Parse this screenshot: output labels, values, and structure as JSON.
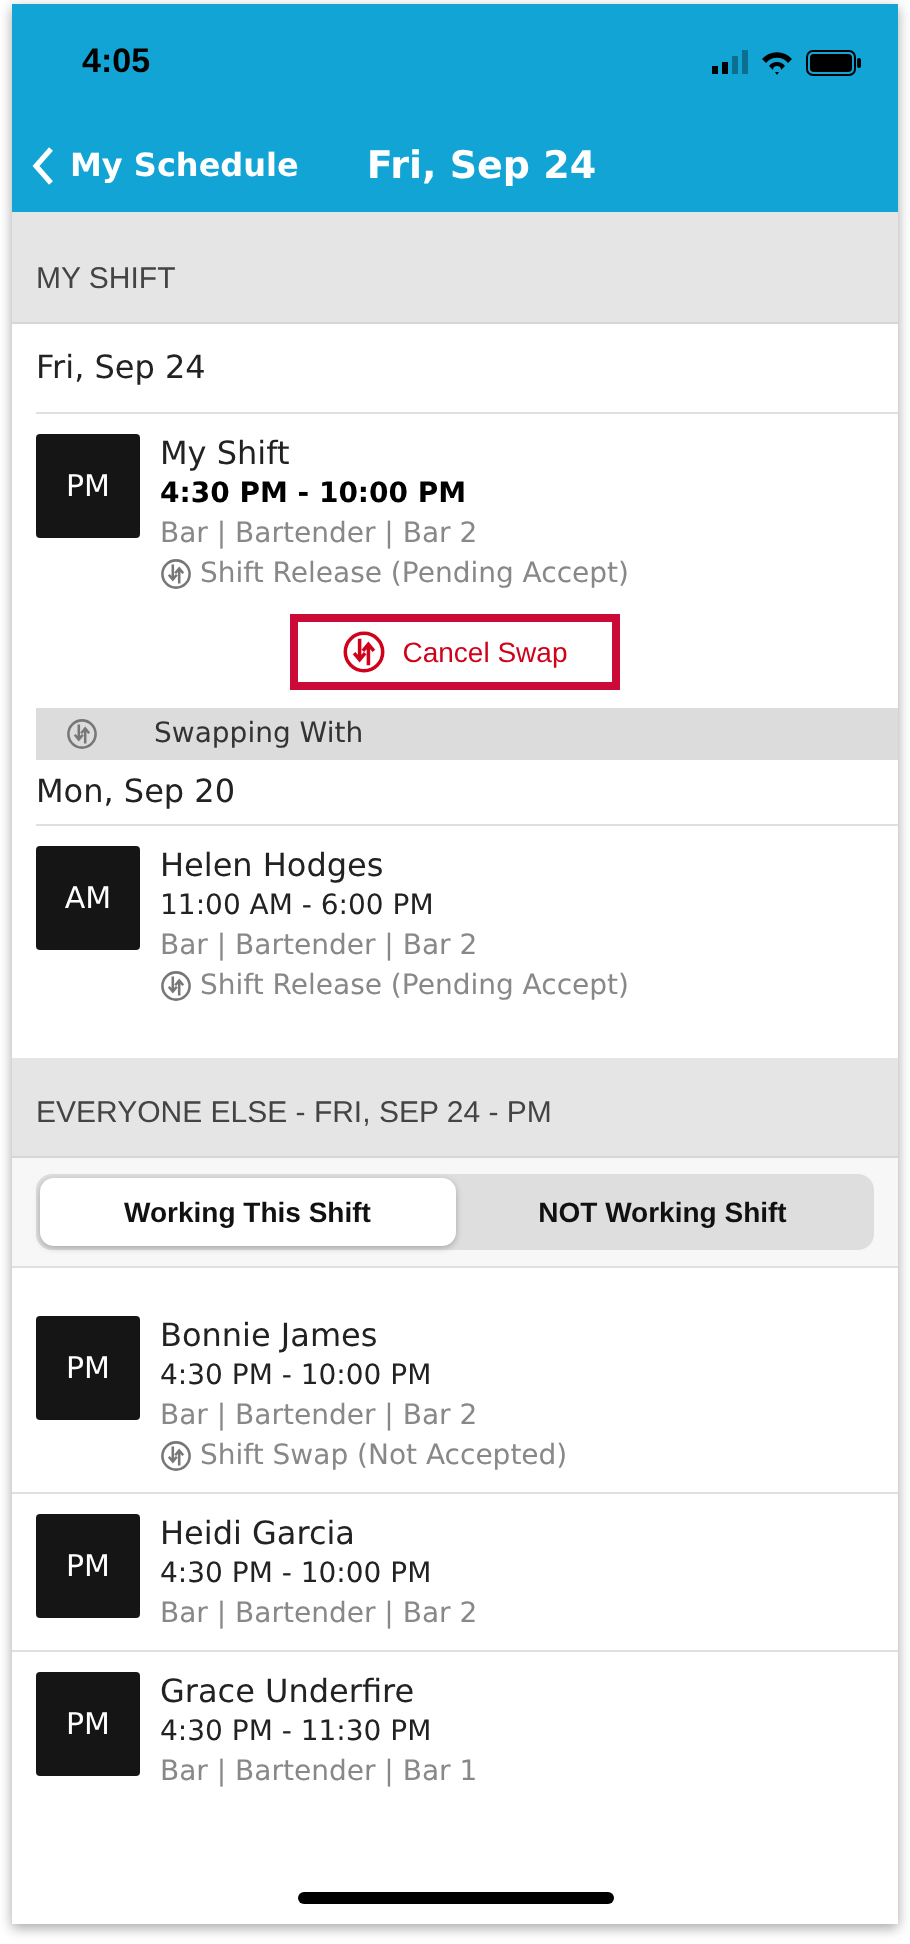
{
  "status_bar": {
    "time": "4:05"
  },
  "nav": {
    "back_label": "My Schedule",
    "title": "Fri, Sep 24"
  },
  "my_shift": {
    "header": "MY SHIFT",
    "date": "Fri, Sep 24",
    "shift": {
      "badge": "PM",
      "name": "My Shift",
      "time": "4:30 PM - 10:00 PM",
      "time_bold": true,
      "detail": "Bar | Bartender | Bar 2",
      "status": "Shift Release (Pending Accept)"
    },
    "action": "Cancel Swap",
    "action_highlighted": true,
    "swap_label": "Swapping With",
    "swap_date": "Mon, Sep 20",
    "swap_shift": {
      "badge": "AM",
      "name": "Helen Hodges",
      "time": "11:00 AM - 6:00 PM",
      "time_bold": false,
      "detail": "Bar | Bartender | Bar 2",
      "status": "Shift Release (Pending Accept)"
    }
  },
  "everyone_else": {
    "header": "EVERYONE ELSE - FRI, SEP 24 - PM",
    "tabs": [
      {
        "label": "Working This Shift",
        "selected": true
      },
      {
        "label": "NOT Working Shift",
        "selected": false
      }
    ],
    "shifts": [
      {
        "badge": "PM",
        "name": "Bonnie James",
        "time": "4:30 PM - 10:00 PM",
        "time_bold": false,
        "detail": "Bar | Bartender | Bar 2",
        "status": "Shift Swap (Not Accepted)"
      },
      {
        "badge": "PM",
        "name": "Heidi Garcia",
        "time": "4:30 PM - 10:00 PM",
        "time_bold": false,
        "detail": "Bar | Bartender | Bar 2"
      },
      {
        "badge": "PM",
        "name": "Grace Underfire",
        "time": "4:30 PM - 11:30 PM",
        "time_bold": false,
        "detail": "Bar | Bartender | Bar 1"
      }
    ]
  }
}
